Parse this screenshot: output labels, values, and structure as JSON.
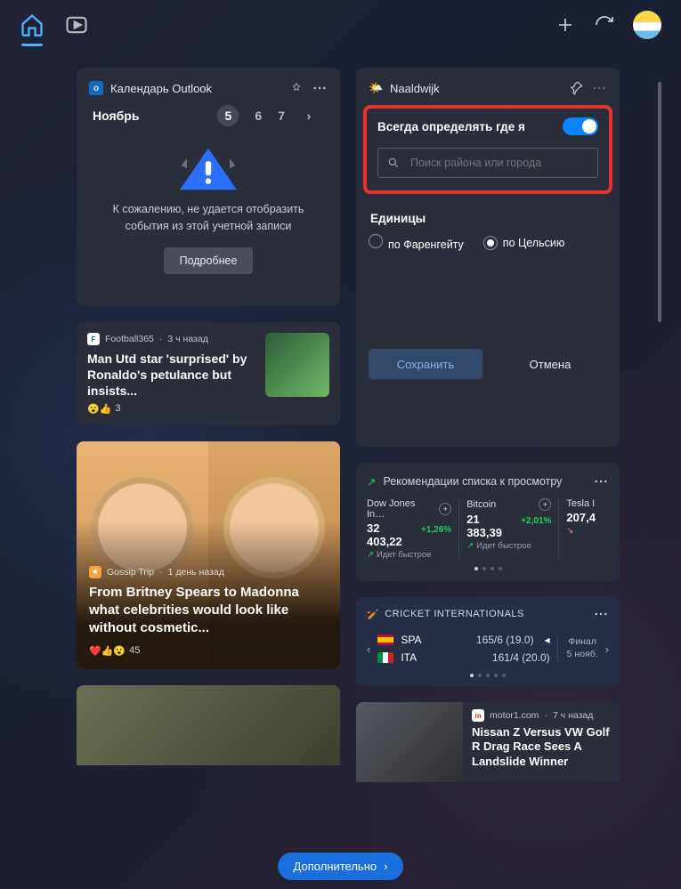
{
  "topbar": {
    "home": "home",
    "video": "video"
  },
  "calendar": {
    "title": "Календарь Outlook",
    "month": "Ноябрь",
    "days": [
      "5",
      "6",
      "7"
    ],
    "selected_day": "5",
    "message_l1": "К сожалению, не удается отобразить",
    "message_l2": "события из этой учетной записи",
    "more": "Подробнее"
  },
  "weather": {
    "location": "Naaldwijk",
    "detect_label": "Всегда определять где я",
    "search_placeholder": "Поиск района или города",
    "units_label": "Единицы",
    "unit_f": "по Фаренгейту",
    "unit_c": "по Цельсию",
    "save": "Сохранить",
    "cancel": "Отмена"
  },
  "news1": {
    "source": "Football365",
    "time": "3 ч назад",
    "headline": "Man Utd star 'surprised' by Ronaldo's petulance but insists...",
    "react_count": "3"
  },
  "news2": {
    "source": "Gossip Trip",
    "time": "1 день назад",
    "headline": "From Britney Spears to Madonna what celebrities would look like without cosmetic...",
    "react_count": "45"
  },
  "news3": {
    "source": "motor1.com",
    "time": "7 ч назад",
    "headline": "Nissan Z Versus VW Golf R Drag Race Sees A Landslide Winner"
  },
  "watchlist": {
    "title": "Рекомендации списка к просмотру",
    "trend": "Идет быстрое",
    "items": [
      {
        "name": "Dow Jones In…",
        "value": "32 403,22",
        "pct": "+1,26%",
        "dir": "up"
      },
      {
        "name": "Bitcoin",
        "value": "21 383,39",
        "pct": "+2,01%",
        "dir": "up"
      },
      {
        "name": "Tesla I",
        "value": "207,4",
        "pct": "",
        "dir": "dn"
      }
    ]
  },
  "cricket": {
    "title": "CRICKET INTERNATIONALS",
    "final": "Финал",
    "date": "5 нояб.",
    "rows": [
      {
        "flag": "es",
        "team": "SPA",
        "score": "165/6 (19.0)"
      },
      {
        "flag": "it",
        "team": "ITA",
        "score": "161/4 (20.0)"
      }
    ]
  },
  "bottom": {
    "label": "Дополнительно"
  },
  "icons": {
    "search": "search",
    "pin": "pin",
    "more": "more",
    "add": "add",
    "refresh": "refresh",
    "chev": "›"
  }
}
